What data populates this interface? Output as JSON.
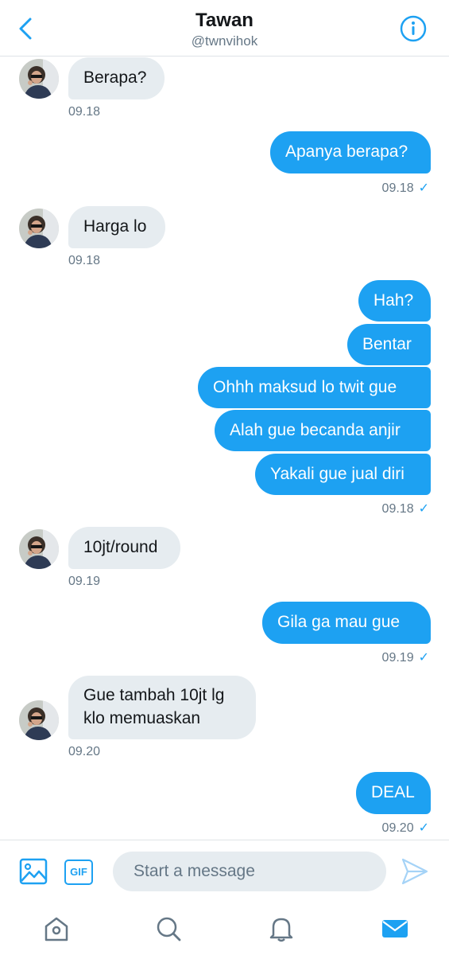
{
  "header": {
    "title": "Tawan",
    "handle": "@twnvihok",
    "back_icon": "chevron-left-icon",
    "info_icon": "info-icon"
  },
  "colors": {
    "accent": "#1da1f2",
    "incoming_bubble": "#e6ecf0",
    "muted": "#657786"
  },
  "messages": [
    {
      "dir": "in",
      "text": "Berapa?",
      "time": "09.18"
    },
    {
      "dir": "out",
      "text": "Apanya berapa?",
      "time": "09.18"
    },
    {
      "dir": "in",
      "text": "Harga lo",
      "time": "09.18"
    },
    {
      "dir": "out",
      "text": "Hah?"
    },
    {
      "dir": "out",
      "text": "Bentar"
    },
    {
      "dir": "out",
      "text": "Ohhh maksud lo twit gue"
    },
    {
      "dir": "out",
      "text": "Alah gue becanda anjir"
    },
    {
      "dir": "out",
      "text": "Yakali gue jual diri",
      "time": "09.18"
    },
    {
      "dir": "in",
      "text": "10jt/round",
      "time": "09.19"
    },
    {
      "dir": "out",
      "text": "Gila ga mau gue",
      "time": "09.19"
    },
    {
      "dir": "in",
      "text": "Gue tambah 10jt lg\nklo memuaskan",
      "line1": "Gue tambah 10jt lg",
      "line2": "klo memuaskan",
      "time": "09.20"
    },
    {
      "dir": "out",
      "text": "DEAL",
      "time": "09.20"
    }
  ],
  "composer": {
    "placeholder": "Start a message",
    "gif_label": "GIF",
    "image_icon": "image-icon",
    "send_icon": "send-icon"
  },
  "tabbar": [
    "home-icon",
    "search-icon",
    "bell-icon",
    "mail-icon"
  ]
}
